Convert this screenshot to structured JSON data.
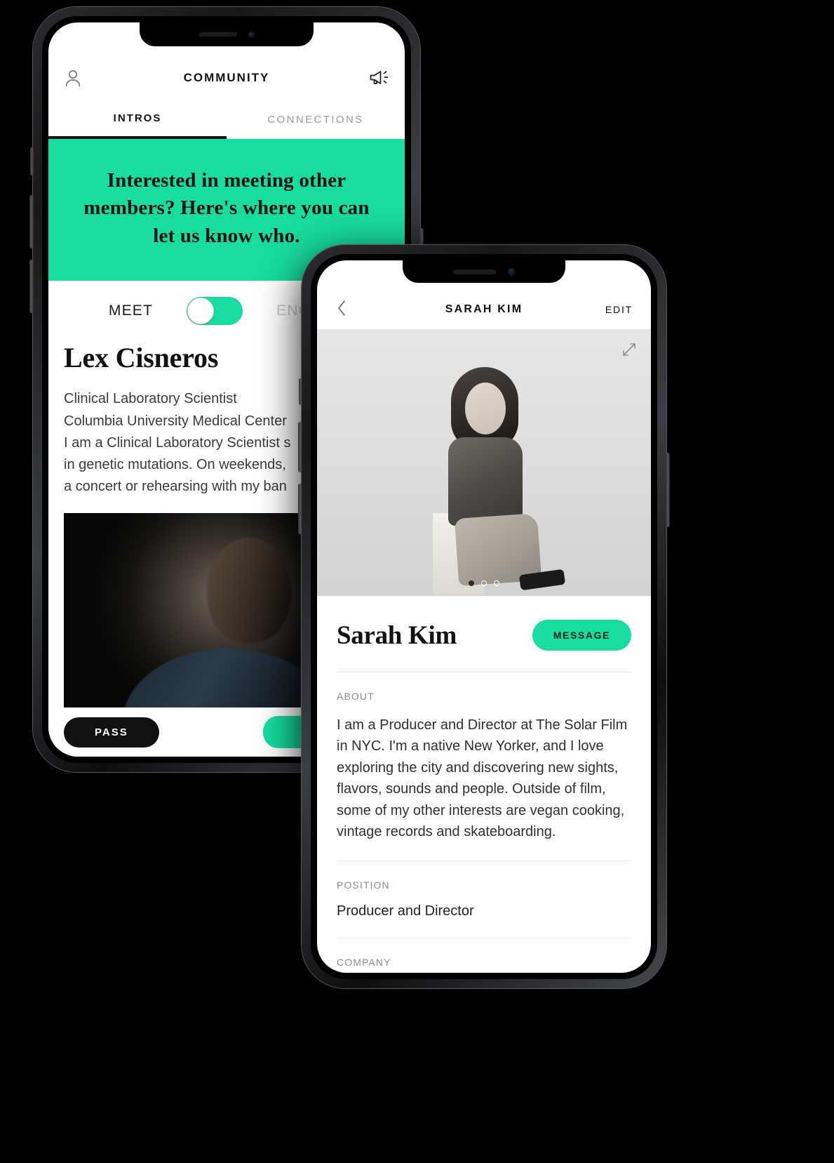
{
  "theme": {
    "accent_green": "#18dca0",
    "text_dark": "#111111",
    "muted": "#8c8c8c"
  },
  "phone_intros": {
    "appbar": {
      "title": "COMMUNITY",
      "profile_icon": "person-icon",
      "announcement_icon": "megaphone-icon"
    },
    "tabs": [
      {
        "label": "INTROS",
        "active": true
      },
      {
        "label": "CONNECTIONS",
        "active": false
      }
    ],
    "banner": {
      "text": "Interested in meeting other members? Here's where you can let us know who."
    },
    "mode_toggle": {
      "left_label": "MEET",
      "right_label": "ENGAGE",
      "state": "on"
    },
    "card": {
      "name": "Lex Cisneros",
      "position": "Clinical Laboratory Scientist",
      "company": "Columbia University Medical Center",
      "bio_line_1": "I am a Clinical Laboratory Scientist s",
      "bio_line_2": "in genetic mutations. On weekends,",
      "bio_line_3": "a concert or rehearsing with my ban",
      "photo_alt": "portrait-photo"
    },
    "actions": {
      "pass_label": "PASS",
      "meet_label": ""
    }
  },
  "phone_profile": {
    "appbar": {
      "back_icon": "chevron-left-icon",
      "title": "SARAH KIM",
      "edit_label": "EDIT"
    },
    "hero": {
      "expand_icon": "expand-icon",
      "photo_alt": "sarah-kim-portrait",
      "dots": [
        "filled",
        "empty",
        "empty"
      ]
    },
    "name": "Sarah Kim",
    "message_label": "MESSAGE",
    "sections": [
      {
        "label": "ABOUT",
        "value": "I am a Producer and Director at The Solar Film in NYC. I'm a native New Yorker, and I love exploring the city and discovering new sights, flavors, sounds and people. Outside of film, some of my other interests are vegan cooking, vintage records and skateboarding."
      },
      {
        "label": "POSITION",
        "value": "Producer and Director"
      },
      {
        "label": "COMPANY",
        "value": ""
      }
    ]
  }
}
